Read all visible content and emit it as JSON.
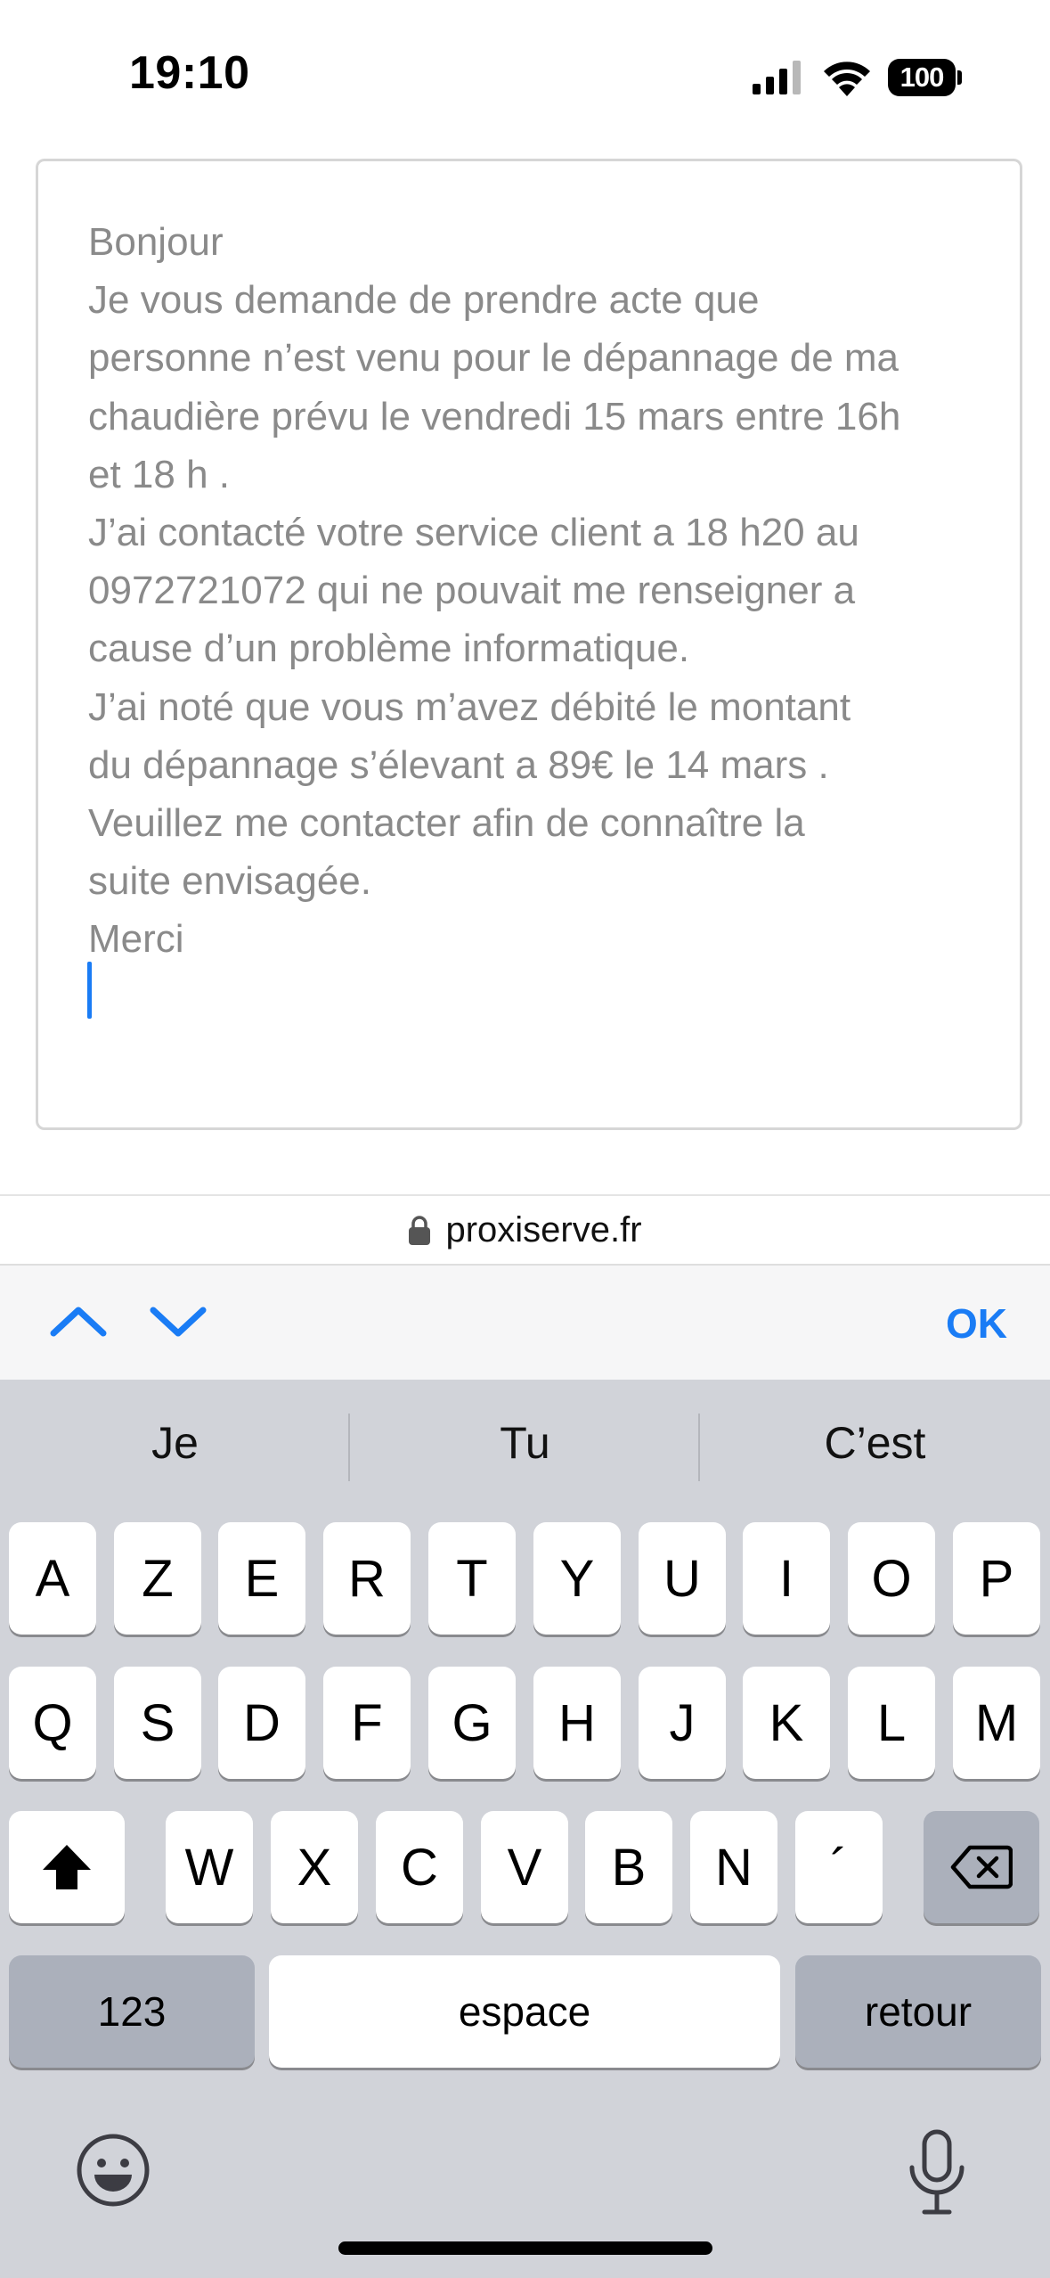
{
  "status_bar": {
    "time": "19:10",
    "battery_level": "100",
    "icons": [
      "signal-icon",
      "wifi-icon",
      "battery-icon"
    ]
  },
  "message": {
    "lines": [
      "Bonjour",
      "Je vous demande de prendre acte que",
      "personne n’est venu pour le dépannage  de ma",
      "chaudière prévu le vendredi 15 mars entre 16h",
      "et 18 h .",
      "J’ai contacté votre service client a 18 h20  au",
      "0972721072  qui  ne pouvait me renseigner a",
      "cause d’un problème informatique.",
      "J’ai noté que vous m’avez débité le montant",
      "du dépannage s’élevant a 89€ le 14 mars .",
      "Veuillez  me contacter afin de  connaître la",
      "suite envisagée.",
      "Merci"
    ],
    "text_color": "#8a8a8a",
    "cursor_color": "#1a7cf5"
  },
  "url_bar": {
    "domain": "proxiserve.fr",
    "icon": "lock-icon"
  },
  "accessory_bar": {
    "ok_label": "OK",
    "icons": [
      "chevron-up-icon",
      "chevron-down-icon"
    ],
    "accent_color": "#1a7cf5"
  },
  "keyboard": {
    "suggestions": [
      "Je",
      "Tu",
      "C’est"
    ],
    "row1": [
      "A",
      "Z",
      "E",
      "R",
      "T",
      "Y",
      "U",
      "I",
      "O",
      "P"
    ],
    "row2": [
      "Q",
      "S",
      "D",
      "F",
      "G",
      "H",
      "J",
      "K",
      "L",
      "M"
    ],
    "row3": [
      "W",
      "X",
      "C",
      "V",
      "B",
      "N",
      "´"
    ],
    "numbers_label": "123",
    "space_label": "espace",
    "return_label": "retour",
    "icons": [
      "shift-icon",
      "backspace-icon",
      "emoji-icon",
      "mic-icon"
    ]
  }
}
